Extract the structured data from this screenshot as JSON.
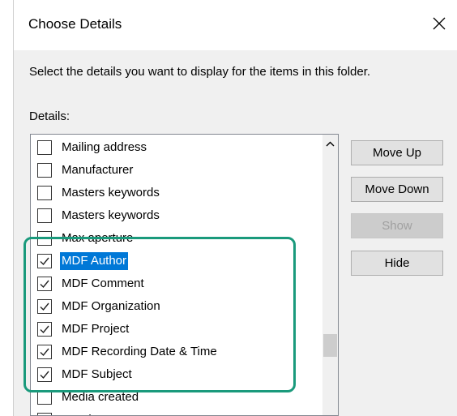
{
  "dialog": {
    "title": "Choose Details",
    "description": "Select the details you want to display for the items in this folder.",
    "details_label": "Details:"
  },
  "list": {
    "items": [
      {
        "label": "Mailing address",
        "checked": false,
        "selected": false
      },
      {
        "label": "Manufacturer",
        "checked": false,
        "selected": false
      },
      {
        "label": "Masters keywords",
        "checked": false,
        "selected": false
      },
      {
        "label": "Masters keywords",
        "checked": false,
        "selected": false
      },
      {
        "label": "Max aperture",
        "checked": false,
        "selected": false
      },
      {
        "label": "MDF Author",
        "checked": true,
        "selected": true
      },
      {
        "label": "MDF Comment",
        "checked": true,
        "selected": false
      },
      {
        "label": "MDF Organization",
        "checked": true,
        "selected": false
      },
      {
        "label": "MDF Project",
        "checked": true,
        "selected": false
      },
      {
        "label": "MDF Recording Date & Time",
        "checked": true,
        "selected": false
      },
      {
        "label": "MDF Subject",
        "checked": true,
        "selected": false
      },
      {
        "label": "Media created",
        "checked": false,
        "selected": false
      },
      {
        "label": "Meeting status",
        "checked": false,
        "selected": false
      }
    ]
  },
  "buttons": {
    "move_up": "Move Up",
    "move_down": "Move Down",
    "show": "Show",
    "hide": "Hide"
  },
  "icons": {
    "close": "close-icon",
    "scroll_up": "chevron-up-icon",
    "check": "checkmark-icon"
  },
  "colors": {
    "selection": "#0078d7",
    "highlight_border": "#1a9a7c"
  }
}
